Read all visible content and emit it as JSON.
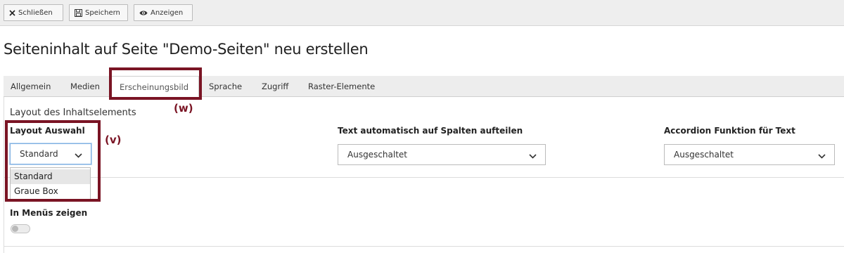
{
  "toolbar": {
    "close_label": "Schließen",
    "save_label": "Speichern",
    "view_label": "Anzeigen"
  },
  "page_title": "Seiteninhalt auf Seite \"Demo-Seiten\" neu erstellen",
  "tabs": [
    {
      "label": "Allgemein"
    },
    {
      "label": "Medien"
    },
    {
      "label": "Erscheinungsbild"
    },
    {
      "label": "Sprache"
    },
    {
      "label": "Zugriff"
    },
    {
      "label": "Raster-Elemente"
    }
  ],
  "section_title": "Layout des Inhaltselements",
  "fields": {
    "layout": {
      "label": "Layout Auswahl",
      "value": "Standard",
      "options": [
        "Standard",
        "Graue Box"
      ]
    },
    "columns": {
      "label": "Text automatisch auf Spalten aufteilen",
      "value": "Ausgeschaltet"
    },
    "accordion": {
      "label": "Accordion Funktion für Text",
      "value": "Ausgeschaltet"
    },
    "menus": {
      "label": "In Menüs zeigen",
      "checked": false
    }
  },
  "annotations": {
    "w": "(w)",
    "v": "(v)"
  },
  "colors": {
    "annotation": "#7a1424",
    "toolbar_bg": "#eeeeee",
    "tabbar_bg": "#ededed",
    "focus_border": "#7fb0e2"
  }
}
